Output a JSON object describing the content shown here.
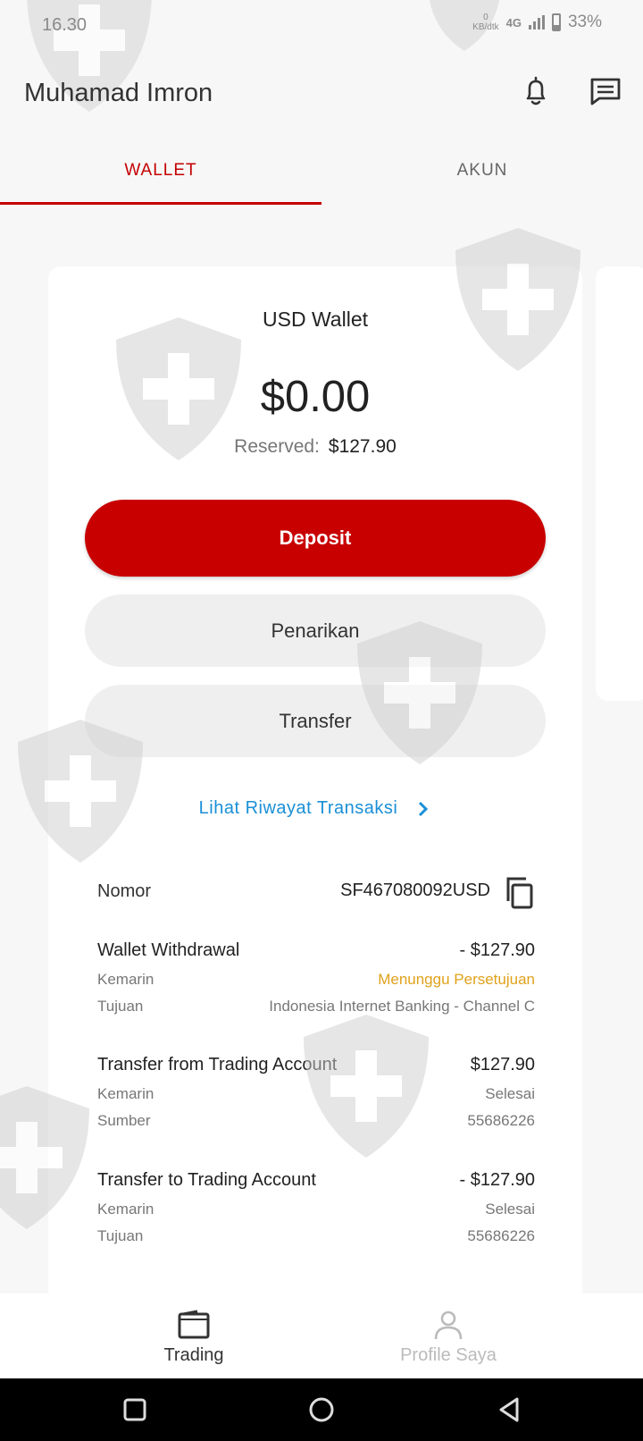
{
  "status_bar": {
    "time": "16.30",
    "data_rate_value": "0",
    "data_rate_unit": "KB/dtk",
    "network": "4G",
    "battery": "33%"
  },
  "header": {
    "user_name": "Muhamad Imron",
    "icons": [
      "bell-icon",
      "message-icon"
    ]
  },
  "tabs": [
    {
      "label": "WALLET",
      "active": true
    },
    {
      "label": "AKUN",
      "active": false
    }
  ],
  "wallet": {
    "title": "USD Wallet",
    "balance": "$0.00",
    "reserved_label": "Reserved:",
    "reserved_value": "$127.90",
    "buttons": {
      "deposit": "Deposit",
      "withdraw": "Penarikan",
      "transfer": "Transfer"
    },
    "history_link": "Lihat Riwayat Transaksi",
    "number_label": "Nomor",
    "number_value": "SF467080092USD"
  },
  "transactions": [
    {
      "title": "Wallet Withdrawal",
      "amount": "- $127.90",
      "date": "Kemarin",
      "status": "Menunggu Persetujuan",
      "status_type": "pending",
      "detail_label": "Tujuan",
      "detail_value": "Indonesia Internet Banking - Channel C"
    },
    {
      "title": "Transfer from Trading Account",
      "amount": "$127.90",
      "date": "Kemarin",
      "status": "Selesai",
      "status_type": "done",
      "detail_label": "Sumber",
      "detail_value": "55686226"
    },
    {
      "title": "Transfer to Trading Account",
      "amount": "- $127.90",
      "date": "Kemarin",
      "status": "Selesai",
      "status_type": "done",
      "detail_label": "Tujuan",
      "detail_value": "55686226"
    }
  ],
  "bottom_nav": [
    {
      "label": "Trading",
      "icon": "wallet-icon",
      "active": true
    },
    {
      "label": "Profile Saya",
      "icon": "person-icon",
      "active": false
    }
  ],
  "colors": {
    "accent": "#c80000",
    "link": "#1a8fd6",
    "pending": "#e0a21b"
  }
}
